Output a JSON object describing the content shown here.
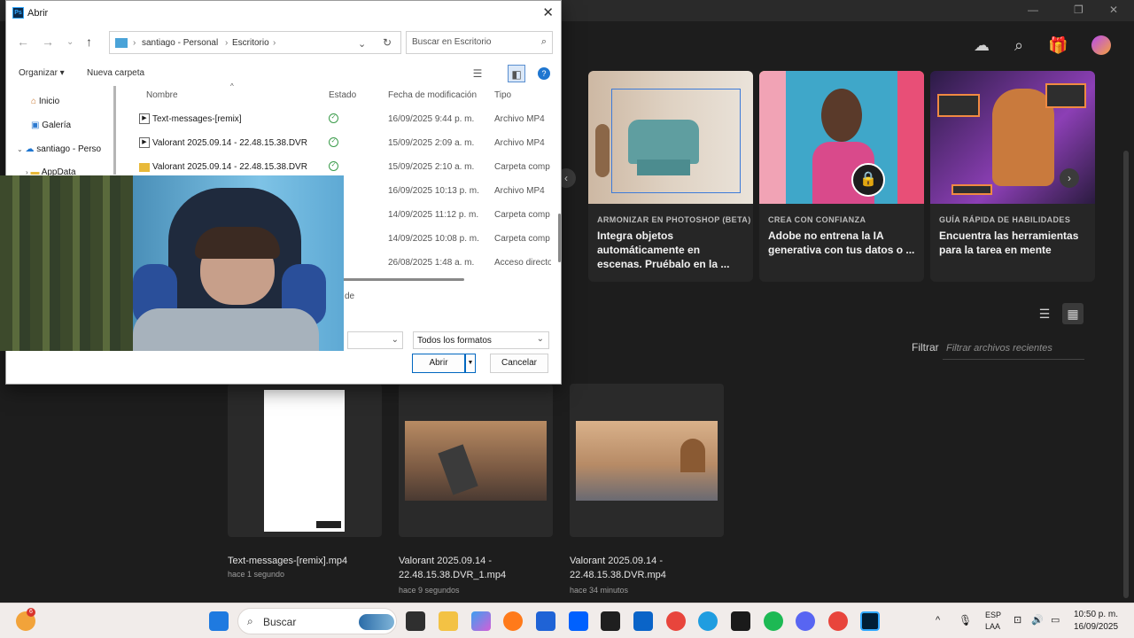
{
  "photoshop": {
    "cards": [
      {
        "kicker": "ARMONIZAR EN PHOTOSHOP (BETA)",
        "title": "Integra objetos automáticamente en escenas. Pruébalo en la ..."
      },
      {
        "kicker": "CREA CON CONFIANZA",
        "title": "Adobe no entrena la IA generativa con tus datos o ..."
      },
      {
        "kicker": "GUÍA RÁPIDA DE HABILIDADES",
        "title": "Encuentra las herramientas para la tarea en mente"
      }
    ],
    "filter_label": "Filtrar",
    "filter_placeholder": "Filtrar archivos recientes",
    "recent_files": [
      {
        "name": "Text-messages-[remix].mp4",
        "time": "hace 1 segundo"
      },
      {
        "name": "Valorant 2025.09.14 - 22.48.15.38.DVR_1.mp4",
        "time": "hace 9 segundos"
      },
      {
        "name": "Valorant 2025.09.14 - 22.48.15.38.DVR.mp4",
        "time": "hace 34 minutos"
      }
    ]
  },
  "dialog": {
    "title": "Abrir",
    "breadcrumb": [
      "santiago - Personal",
      "Escritorio"
    ],
    "search_placeholder": "Buscar en Escritorio",
    "organize": "Organizar ▾",
    "new_folder": "Nueva carpeta",
    "sidebar": [
      "Inicio",
      "Galería",
      "santiago - Perso",
      "AppData"
    ],
    "columns": {
      "name": "Nombre",
      "status": "Estado",
      "modified": "Fecha de modificación",
      "type": "Tipo"
    },
    "files": [
      {
        "name": "Text-messages-[remix]",
        "status": "✓",
        "modified": "16/09/2025 9:44 p. m.",
        "type": "Archivo MP4",
        "kind": "video"
      },
      {
        "name": "Valorant 2025.09.14 - 22.48.15.38.DVR",
        "status": "✓",
        "modified": "15/09/2025 2:09 a. m.",
        "type": "Archivo MP4",
        "kind": "video"
      },
      {
        "name": "Valorant 2025.09.14 - 22.48.15.38.DVR",
        "status": "✓",
        "modified": "15/09/2025 2:10 a. m.",
        "type": "Carpeta comp",
        "kind": "folder"
      },
      {
        "name": "",
        "status": "",
        "modified": "16/09/2025 10:13 p. m.",
        "type": "Archivo MP4",
        "kind": "video"
      },
      {
        "name": "",
        "status": "",
        "modified": "14/09/2025 11:12 p. m.",
        "type": "Carpeta comp",
        "kind": "folder"
      },
      {
        "name": "",
        "status": "",
        "modified": "14/09/2025 10:08 p. m.",
        "type": "Carpeta comp",
        "kind": "folder"
      },
      {
        "name": "",
        "status": "",
        "modified": "26/08/2025 1:48 a. m.",
        "type": "Acceso directo",
        "kind": "shortcut"
      }
    ],
    "partial_label": "de",
    "format": "Todos los formatos",
    "open": "Abrir",
    "cancel": "Cancelar"
  },
  "taskbar": {
    "search": "Buscar",
    "lang1": "ESP",
    "lang2": "LAA",
    "time": "10:50 p. m.",
    "date": "16/09/2025",
    "weather_badge": "6"
  }
}
